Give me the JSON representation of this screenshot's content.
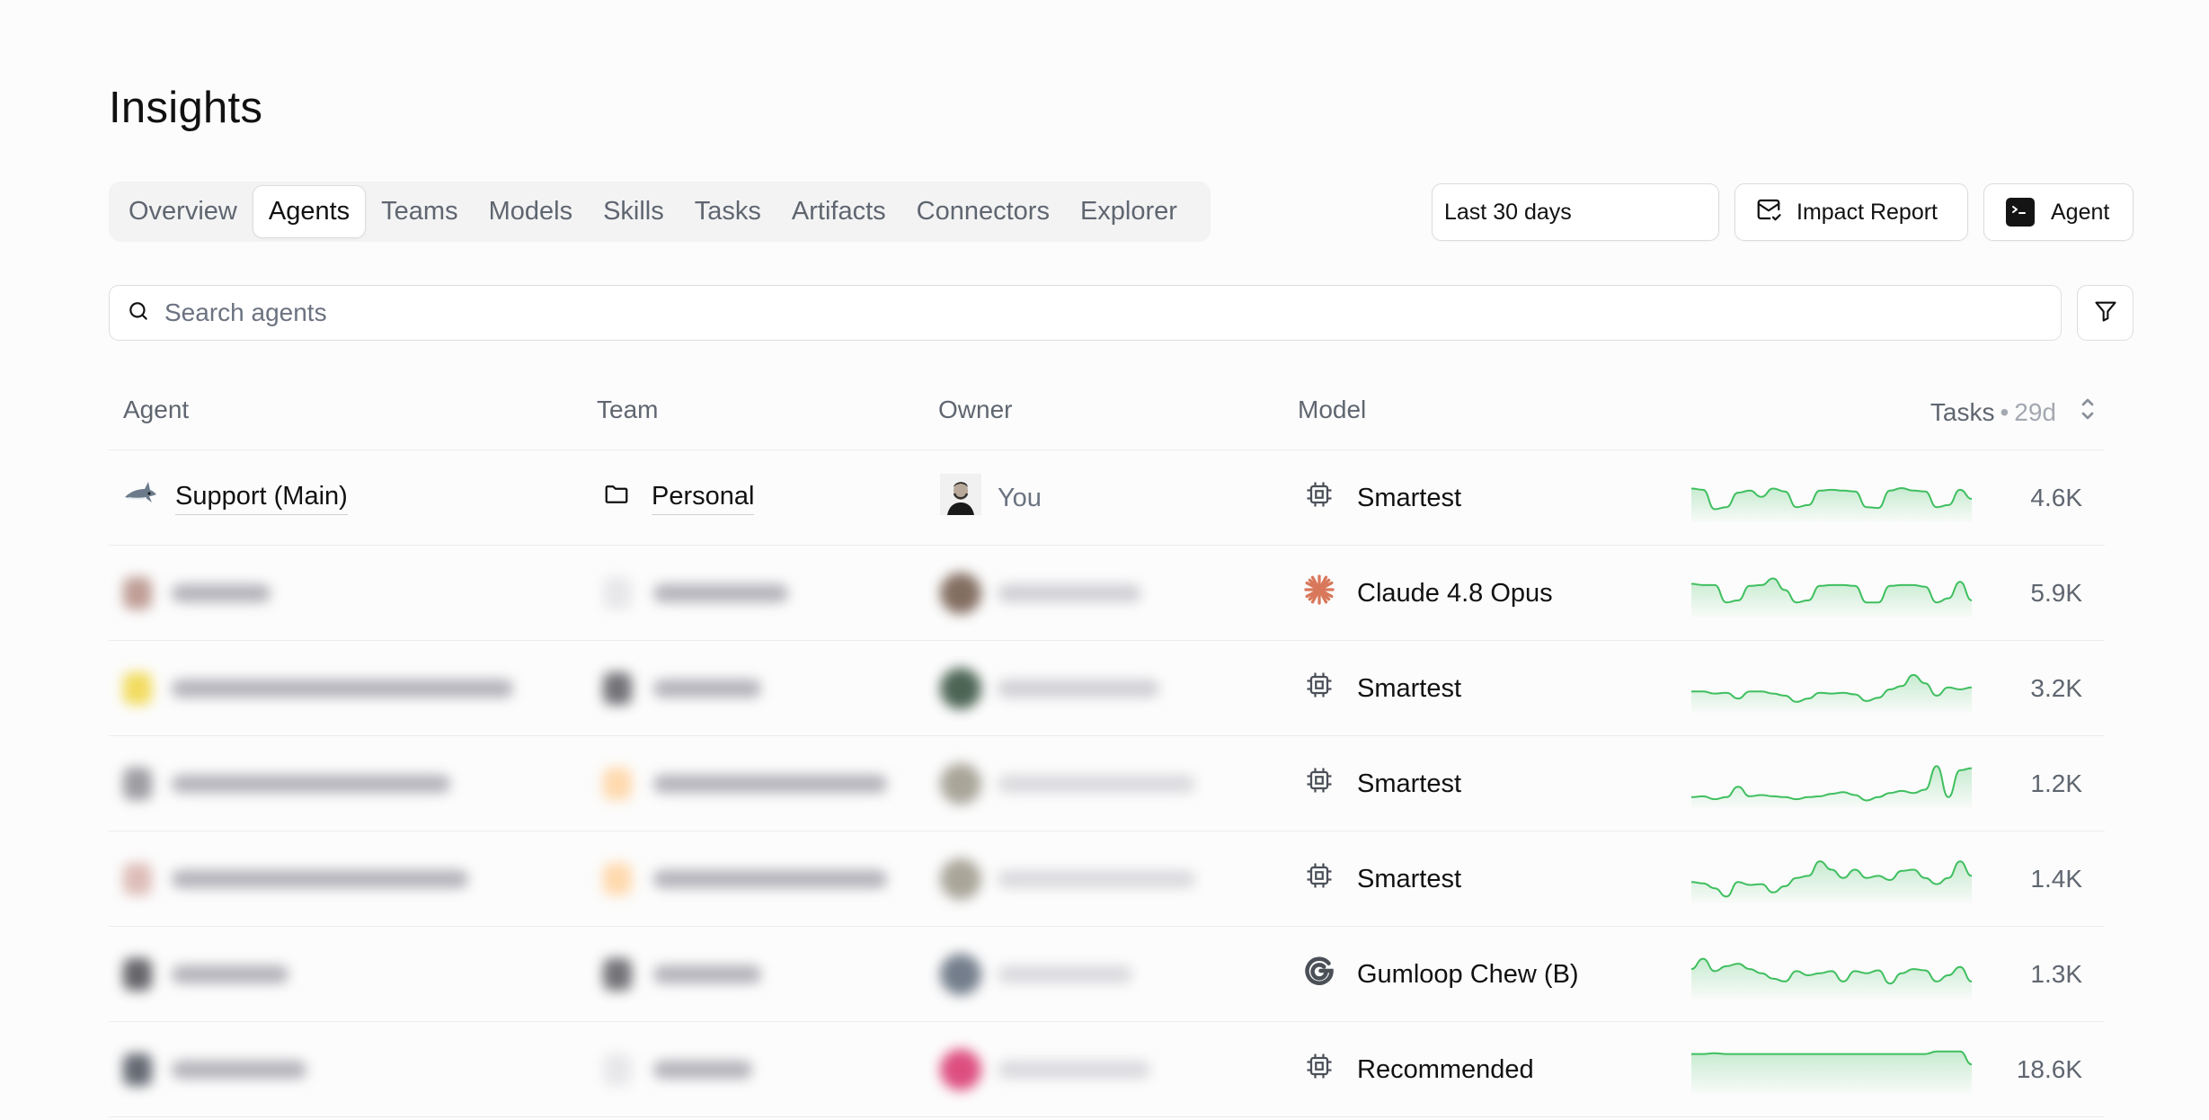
{
  "page": {
    "title": "Insights"
  },
  "tabs": [
    {
      "label": "Overview",
      "active": false
    },
    {
      "label": "Agents",
      "active": true
    },
    {
      "label": "Teams",
      "active": false
    },
    {
      "label": "Models",
      "active": false
    },
    {
      "label": "Skills",
      "active": false
    },
    {
      "label": "Tasks",
      "active": false
    },
    {
      "label": "Artifacts",
      "active": false
    },
    {
      "label": "Connectors",
      "active": false
    },
    {
      "label": "Explorer",
      "active": false
    }
  ],
  "toolbar": {
    "date_range": "Last 30 days",
    "impact_report_label": "Impact Report",
    "agent_button_label": "Agent"
  },
  "search": {
    "placeholder": "Search agents",
    "value": ""
  },
  "table": {
    "headers": {
      "agent": "Agent",
      "team": "Team",
      "owner": "Owner",
      "model": "Model",
      "tasks": "Tasks",
      "tasks_separator": "•",
      "tasks_period": "29d"
    },
    "rows": [
      {
        "agent": "Support (Main)",
        "team": "Personal",
        "owner": "You",
        "model": "Smartest",
        "model_icon": "cpu-icon",
        "tasks": "4.6K",
        "blurred": false,
        "trend": [
          0.75,
          0.72,
          0.25,
          0.3,
          0.65,
          0.7,
          0.55,
          0.75,
          0.68,
          0.3,
          0.35,
          0.7,
          0.72,
          0.7,
          0.68,
          0.3,
          0.28,
          0.7,
          0.76,
          0.7,
          0.68,
          0.3,
          0.35,
          0.72,
          0.5
        ]
      },
      {
        "agent": "",
        "team": "",
        "owner": "",
        "model": "Claude 4.8 Opus",
        "model_icon": "claude-asterisk-icon",
        "tasks": "5.9K",
        "blurred": true,
        "trend": [
          0.75,
          0.72,
          0.72,
          0.3,
          0.35,
          0.7,
          0.72,
          0.88,
          0.6,
          0.3,
          0.35,
          0.7,
          0.72,
          0.72,
          0.7,
          0.3,
          0.3,
          0.7,
          0.72,
          0.72,
          0.68,
          0.3,
          0.4,
          0.8,
          0.35
        ]
      },
      {
        "agent": "",
        "team": "",
        "owner": "",
        "model": "Smartest",
        "model_icon": "cpu-icon",
        "tasks": "3.2K",
        "blurred": true,
        "trend": [
          0.45,
          0.45,
          0.4,
          0.42,
          0.28,
          0.45,
          0.45,
          0.4,
          0.35,
          0.2,
          0.28,
          0.42,
          0.4,
          0.42,
          0.38,
          0.22,
          0.3,
          0.5,
          0.58,
          0.85,
          0.65,
          0.35,
          0.55,
          0.5,
          0.55
        ]
      },
      {
        "agent": "",
        "team": "",
        "owner": "",
        "model": "Smartest",
        "model_icon": "cpu-icon",
        "tasks": "1.2K",
        "blurred": true,
        "trend": [
          0.2,
          0.22,
          0.15,
          0.2,
          0.45,
          0.22,
          0.25,
          0.22,
          0.2,
          0.15,
          0.2,
          0.22,
          0.28,
          0.32,
          0.25,
          0.12,
          0.2,
          0.3,
          0.35,
          0.3,
          0.38,
          0.95,
          0.2,
          0.85,
          0.9
        ]
      },
      {
        "agent": "",
        "team": "",
        "owner": "",
        "model": "Smartest",
        "model_icon": "cpu-icon",
        "tasks": "1.4K",
        "blurred": true,
        "trend": [
          0.45,
          0.42,
          0.3,
          0.1,
          0.45,
          0.38,
          0.4,
          0.2,
          0.35,
          0.55,
          0.6,
          0.95,
          0.75,
          0.55,
          0.75,
          0.55,
          0.6,
          0.5,
          0.72,
          0.75,
          0.55,
          0.4,
          0.55,
          0.95,
          0.6
        ]
      },
      {
        "agent": "",
        "team": "",
        "owner": "",
        "model": "Gumloop Chew (B)",
        "model_icon": "gumloop-icon",
        "tasks": "1.3K",
        "blurred": true,
        "trend": [
          0.65,
          0.9,
          0.6,
          0.72,
          0.78,
          0.65,
          0.55,
          0.42,
          0.35,
          0.6,
          0.5,
          0.55,
          0.6,
          0.35,
          0.6,
          0.55,
          0.62,
          0.3,
          0.55,
          0.65,
          0.62,
          0.35,
          0.5,
          0.7,
          0.35
        ]
      },
      {
        "agent": "",
        "team": "",
        "owner": "",
        "model": "Recommended",
        "model_icon": "cpu-icon",
        "tasks": "18.6K",
        "blurred": true,
        "trend": [
          0.9,
          0.9,
          0.92,
          0.9,
          0.9,
          0.9,
          0.9,
          0.9,
          0.9,
          0.9,
          0.9,
          0.9,
          0.9,
          0.9,
          0.9,
          0.9,
          0.9,
          0.9,
          0.9,
          0.9,
          0.9,
          0.96,
          0.96,
          0.96,
          0.65
        ]
      }
    ]
  },
  "colors": {
    "accent_green": "#3fbf5f",
    "claude_orange": "#d9775a",
    "text_muted": "#6b7280"
  }
}
